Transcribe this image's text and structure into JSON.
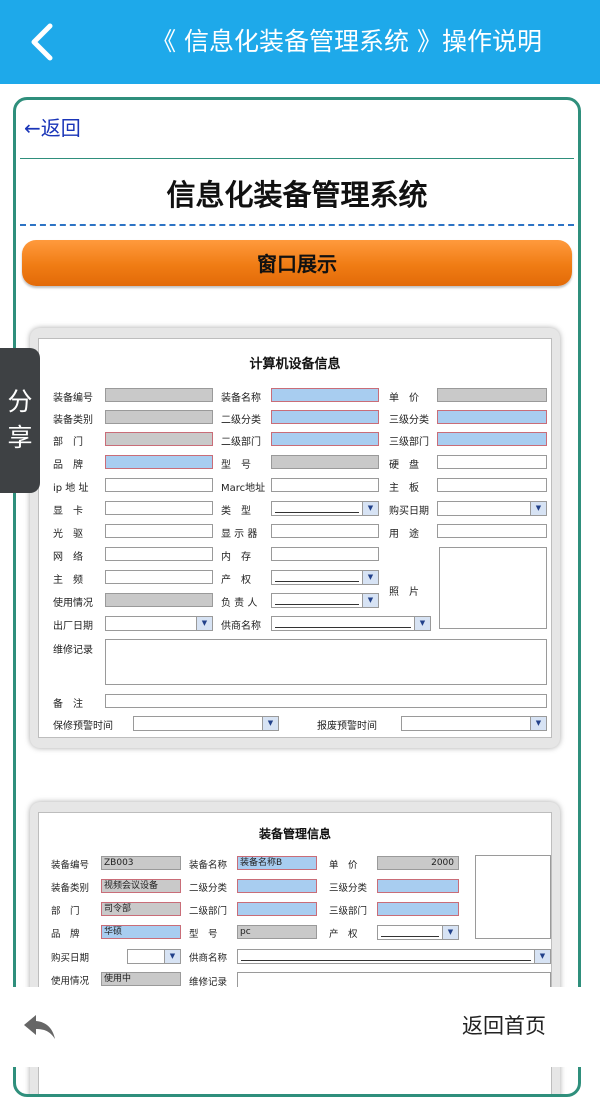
{
  "header": {
    "title": "《 信息化装备管理系统 》操作说明"
  },
  "article": {
    "back_link": "←返回",
    "title": "信息化装备管理系统",
    "section_button": "窗口展示"
  },
  "screenshot1": {
    "title": "计算机设备信息",
    "labels": {
      "equip_no": "装备编号",
      "equip_name": "装备名称",
      "unit_price": "单　价",
      "equip_category": "装备类别",
      "class2": "二级分类",
      "class3": "三级分类",
      "dept": "部　门",
      "dept2": "二级部门",
      "dept3": "三级部门",
      "brand": "品　牌",
      "model": "型　号",
      "hdd": "硬　盘",
      "ip": "ip 地 址",
      "mac": "Marc地址",
      "board": "主　板",
      "gpu": "显　卡",
      "type": "类　型",
      "buy_date": "购买日期",
      "optical": "光　驱",
      "monitor": "显 示 器",
      "usage": "用　途",
      "network": "网　络",
      "memory": "内　存",
      "cpu_freq": "主　频",
      "property": "产　权",
      "photo": "照　片",
      "use_status": "使用情况",
      "owner": "负 责 人",
      "factory_date": "出厂日期",
      "supplier": "供商名称",
      "repair": "维修记录",
      "remark": "备　注",
      "warranty_alert": "保修预警时间",
      "scrap_alert": "报废预警时间"
    }
  },
  "screenshot2": {
    "title": "装备管理信息",
    "labels": {
      "equip_no": "装备编号",
      "equip_name": "装备名称",
      "unit_price": "单　价",
      "equip_category": "装备类别",
      "class2": "二级分类",
      "class3": "三级分类",
      "dept": "部　门",
      "dept2": "二级部门",
      "dept3": "三级部门",
      "brand": "品　牌",
      "model": "型　号",
      "property": "产　权",
      "buy_date": "购买日期",
      "supplier": "供商名称",
      "use_status": "使用情况",
      "repair": "维修记录"
    },
    "values": {
      "equip_no": "ZB003",
      "equip_name": "装备名称B",
      "unit_price": "2000",
      "equip_category": "视频会议设备",
      "dept": "司令部",
      "brand": "华硕",
      "model": "pc",
      "use_status": "使用中"
    }
  },
  "share_tab": {
    "line1": "分",
    "line2": "享"
  },
  "bottom": {
    "home_link": "返回首页"
  },
  "colors": {
    "header": "#1ea9ea",
    "frame_border": "#2f8f7c",
    "button": "#f07c14",
    "link": "#1a35b8"
  },
  "icons": {
    "back": "chevron-left-icon",
    "reply": "reply-arrow-icon"
  }
}
